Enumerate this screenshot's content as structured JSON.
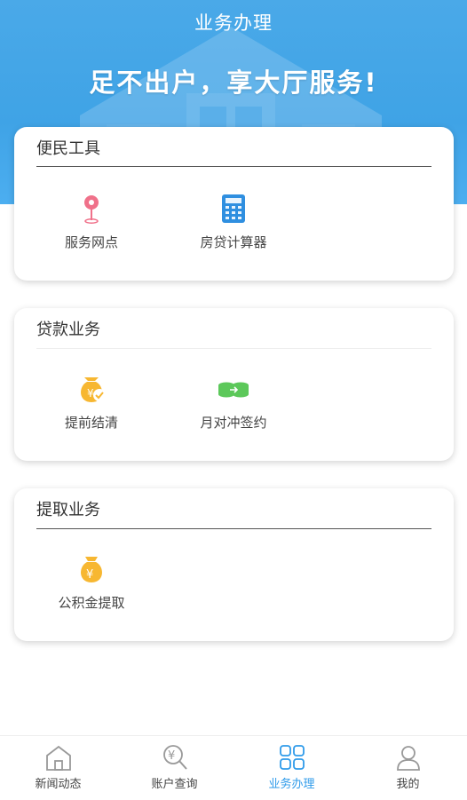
{
  "header": {
    "title": "业务办理",
    "slogan": "足不出户，享大厅服务!"
  },
  "sections": [
    {
      "title": "便民工具",
      "items": [
        {
          "label": "服务网点",
          "icon": "location-pin-icon"
        },
        {
          "label": "房贷计算器",
          "icon": "calculator-icon"
        }
      ]
    },
    {
      "title": "贷款业务",
      "items": [
        {
          "label": "提前结清",
          "icon": "money-bag-check-icon"
        },
        {
          "label": "月对冲签约",
          "icon": "coin-stacks-icon"
        }
      ]
    },
    {
      "title": "提取业务",
      "items": [
        {
          "label": "公积金提取",
          "icon": "money-bag-yuan-icon"
        }
      ]
    }
  ],
  "nav": {
    "items": [
      {
        "label": "新闻动态",
        "icon": "house-icon"
      },
      {
        "label": "账户查询",
        "icon": "yuan-search-icon"
      },
      {
        "label": "业务办理",
        "icon": "grid-icon"
      },
      {
        "label": "我的",
        "icon": "user-icon"
      }
    ],
    "active": "业务办理"
  },
  "colors": {
    "primary": "#3fa3e6",
    "active_tab": "#2f9bea",
    "pin": "#f0718a",
    "calculator": "#2f8fe0",
    "bag": "#f7b731",
    "coins": "#5cc85a"
  }
}
